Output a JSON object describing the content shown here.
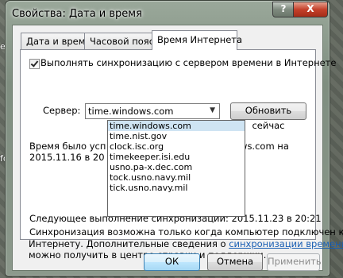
{
  "window": {
    "title": "Свойства: Дата и время",
    "help_label": "?",
    "close_label": "X"
  },
  "desktop": {
    "labels": [
      "e",
      "fo"
    ]
  },
  "tabs": [
    {
      "label": "Дата и время"
    },
    {
      "label": "Часовой пояс"
    },
    {
      "label": "Время Интернета"
    }
  ],
  "sync": {
    "checkbox_label": "Выполнять синхронизацию с сервером времени в Интернете",
    "checked": true,
    "server_label": "Сервер:",
    "server_value": "time.windows.com",
    "update_button": "Обновить сейчас",
    "server_options": [
      "time.windows.com",
      "time.nist.gov",
      "clock.isc.org",
      "timekeeper.isi.edu",
      "usno.pa-x.dec.com",
      "tock.usno.navy.mil",
      "tick.usno.navy.mil"
    ],
    "last_sync_line1_left": "Время было усп",
    "last_sync_line1_right": "ows.com на",
    "last_sync_line2": "2015.11.16 в 20",
    "next_sync": "Следующее выполнение синхронизации: 2015.11.23 в 20:21",
    "info_line1": "Синхронизация возможна только когда компьютер подключен к",
    "info_line2_prefix": "Интернету. Дополнительные сведения о ",
    "info_link": "синхронизации времени",
    "info_line3": "можно получить в центре справки и поддержки."
  },
  "buttons": {
    "ok": "ОК",
    "cancel": "Отмена",
    "apply": "Применить"
  }
}
